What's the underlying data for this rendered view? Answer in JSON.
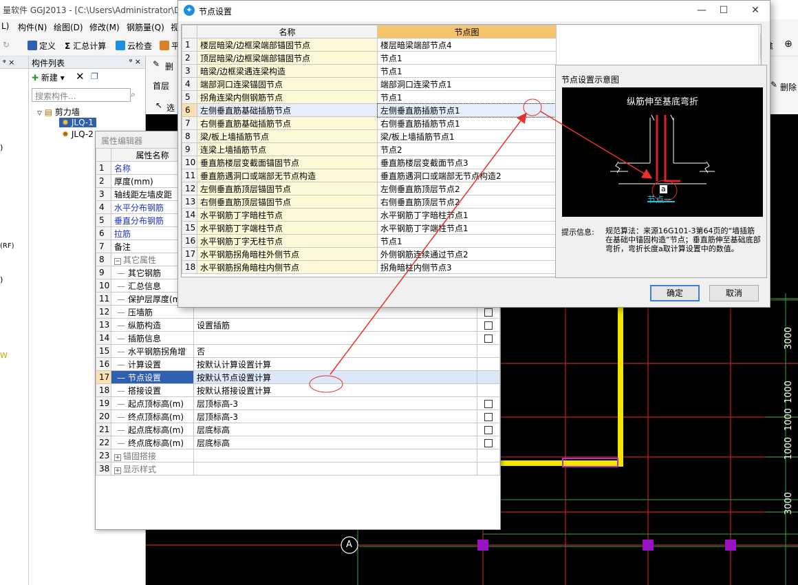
{
  "app": {
    "title": "量软件 GGJ2013 - [C:\\Users\\Administrator\\De",
    "menus": [
      "L)",
      "构件(N)",
      "绘图(D)",
      "修改(M)",
      "钢筋量(Q)",
      "视"
    ],
    "toolbar": [
      "定义",
      "汇总计算",
      "云检查",
      "平"
    ],
    "right_toolbar": [
      "推",
      "删除"
    ],
    "layer_label": "首层",
    "select_label": "选",
    "delete_label": "删"
  },
  "component_panel": {
    "title": "构件列表",
    "new_label": "新建",
    "search_placeholder": "搜索构件...",
    "tree_root": "剪力墙",
    "items": [
      "JLQ-1",
      "JLQ-2"
    ]
  },
  "left_strip": {
    "marks": [
      ")",
      "(RF)",
      ")",
      "W"
    ]
  },
  "property_editor": {
    "title": "属性编辑器",
    "header": "属性名称",
    "rows": [
      {
        "num": "1",
        "name": "名称",
        "value": "",
        "style": "blue",
        "cb": false
      },
      {
        "num": "2",
        "name": "厚度(mm)",
        "value": "",
        "style": "",
        "cb": false
      },
      {
        "num": "3",
        "name": "轴线距左墙皮距",
        "value": "",
        "style": "",
        "cb": false
      },
      {
        "num": "4",
        "name": "水平分布钢筋",
        "value": "",
        "style": "blue",
        "cb": false
      },
      {
        "num": "5",
        "name": "垂直分布钢筋",
        "value": "",
        "style": "blue",
        "cb": false
      },
      {
        "num": "6",
        "name": "拉筋",
        "value": "",
        "style": "blue",
        "cb": false
      },
      {
        "num": "7",
        "name": "备注",
        "value": "",
        "style": "",
        "cb": false
      },
      {
        "num": "8",
        "name": "其它属性",
        "value": "",
        "style": "grey",
        "cb": false,
        "group": "−"
      },
      {
        "num": "9",
        "name": "其它钢筋",
        "value": "",
        "style": "",
        "cb": false,
        "indent": true
      },
      {
        "num": "10",
        "name": "汇总信息",
        "value": "",
        "style": "",
        "cb": false,
        "indent": true
      },
      {
        "num": "11",
        "name": "保护层厚度(mm)",
        "value": "",
        "style": "",
        "cb": true,
        "indent": true
      },
      {
        "num": "12",
        "name": "压墙筋",
        "value": "",
        "style": "",
        "cb": true,
        "indent": true
      },
      {
        "num": "13",
        "name": "纵筋构造",
        "value": "设置插筋",
        "style": "",
        "cb": true,
        "indent": true
      },
      {
        "num": "14",
        "name": "插筋信息",
        "value": "",
        "style": "",
        "cb": true,
        "indent": true
      },
      {
        "num": "15",
        "name": "水平钢筋拐角增",
        "value": "否",
        "style": "",
        "cb": false,
        "indent": true
      },
      {
        "num": "16",
        "name": "计算设置",
        "value": "按默认计算设置计算",
        "style": "",
        "cb": false,
        "indent": true
      },
      {
        "num": "17",
        "name": "节点设置",
        "value": "按默认节点设置计算",
        "style": "",
        "cb": false,
        "indent": true,
        "selected": true
      },
      {
        "num": "18",
        "name": "搭接设置",
        "value": "按默认搭接设置计算",
        "style": "",
        "cb": false,
        "indent": true
      },
      {
        "num": "19",
        "name": "起点顶标高(m)",
        "value": "层顶标高-3",
        "style": "",
        "cb": true,
        "indent": true
      },
      {
        "num": "20",
        "name": "终点顶标高(m)",
        "value": "层顶标高-3",
        "style": "",
        "cb": true,
        "indent": true
      },
      {
        "num": "21",
        "name": "起点底标高(m)",
        "value": "层底标高",
        "style": "",
        "cb": true,
        "indent": true
      },
      {
        "num": "22",
        "name": "终点底标高(m)",
        "value": "层底标高",
        "style": "",
        "cb": true,
        "indent": true
      },
      {
        "num": "23",
        "name": "锚固搭接",
        "value": "",
        "style": "grey",
        "cb": false,
        "group": "+"
      },
      {
        "num": "38",
        "name": "显示样式",
        "value": "",
        "style": "grey",
        "cb": false,
        "group": "+"
      }
    ]
  },
  "node_dialog": {
    "title": "节点设置",
    "col_name": "名称",
    "col_node": "节点图",
    "rows": [
      {
        "num": "1",
        "name": "楼层暗梁/边框梁端部锚固节点",
        "node": "楼层暗梁端部节点4"
      },
      {
        "num": "2",
        "name": "顶层暗梁/边框梁端部锚固节点",
        "node": "节点1"
      },
      {
        "num": "3",
        "name": "暗梁/边框梁遇连梁构造",
        "node": "节点1"
      },
      {
        "num": "4",
        "name": "端部洞口连梁锚固节点",
        "node": "端部洞口连梁节点1"
      },
      {
        "num": "5",
        "name": "拐角连梁内侧钢筋节点",
        "node": "节点1"
      },
      {
        "num": "6",
        "name": "左侧垂直筋基础插筋节点",
        "node": "左侧垂直筋插筋节点1",
        "selected": true
      },
      {
        "num": "7",
        "name": "右侧垂直筋基础插筋节点",
        "node": "右侧垂直筋插筋节点1"
      },
      {
        "num": "8",
        "name": "梁/板上墙插筋节点",
        "node": "梁/板上墙插筋节点1"
      },
      {
        "num": "9",
        "name": "连梁上墙插筋节点",
        "node": "节点2"
      },
      {
        "num": "10",
        "name": "垂直筋楼层变截面锚固节点",
        "node": "垂直筋楼层变截面节点3"
      },
      {
        "num": "11",
        "name": "垂直筋遇洞口或端部无节点构造",
        "node": "垂直筋遇洞口或端部无节点构造2"
      },
      {
        "num": "12",
        "name": "左侧垂直筋顶层锚固节点",
        "node": "左侧垂直筋顶层节点2"
      },
      {
        "num": "13",
        "name": "右侧垂直筋顶层锚固节点",
        "node": "右侧垂直筋顶层节点2"
      },
      {
        "num": "14",
        "name": "水平钢筋丁字暗柱节点",
        "node": "水平钢筋丁字暗柱节点1"
      },
      {
        "num": "15",
        "name": "水平钢筋丁字端柱节点",
        "node": "水平钢筋丁字端柱节点1"
      },
      {
        "num": "16",
        "name": "水平钢筋丁字无柱节点",
        "node": "节点1"
      },
      {
        "num": "17",
        "name": "水平钢筋拐角暗柱外侧节点",
        "node": "外侧钢筋连续通过节点2"
      },
      {
        "num": "18",
        "name": "水平钢筋拐角暗柱内侧节点",
        "node": "拐角暗柱内侧节点3"
      }
    ],
    "preview_title": "节点设置示意图",
    "preview_caption": "纵筋伸至基底弯折",
    "preview_node_label": "节点一",
    "preview_dim": "a",
    "hint_label": "提示信息:",
    "hint_text": "规范算法：来源16G101-3第64页的“墙插筋在基础中锚固构造”节点；垂直筋伸至基础底部弯折，弯折长度a取计算设置中的数值。",
    "ok_label": "确定",
    "cancel_label": "取消"
  },
  "canvas": {
    "dims": [
      "3000",
      "1000",
      "1000",
      "1000",
      "3000"
    ],
    "axis": "A"
  }
}
